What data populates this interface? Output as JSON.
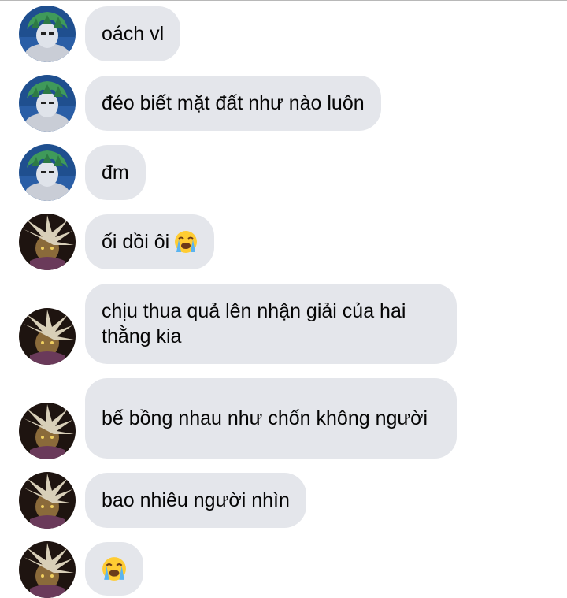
{
  "conversation": {
    "messages": [
      {
        "sender": "user-a",
        "text": "oách vl",
        "emoji": ""
      },
      {
        "sender": "user-a",
        "text": "đéo biết mặt đất như nào luôn",
        "emoji": ""
      },
      {
        "sender": "user-a",
        "text": "đm",
        "emoji": ""
      },
      {
        "sender": "user-b",
        "text": "ối dồi ôi",
        "emoji": "loudly-crying-face-icon"
      },
      {
        "sender": "user-b",
        "text": "chịu thua quả lên nhận giải của hai thằng kia",
        "emoji": ""
      },
      {
        "sender": "user-b",
        "text": "bế bồng nhau như chốn không người",
        "emoji": ""
      },
      {
        "sender": "user-b",
        "text": "bao nhiêu người nhìn",
        "emoji": ""
      },
      {
        "sender": "user-b",
        "text": "",
        "emoji": "loudly-crying-face-icon"
      }
    ]
  },
  "colors": {
    "bubble_bg": "#e4e6eb",
    "text": "#050505",
    "avatar_a_bg": "#1f4f8f",
    "avatar_a_hair": "#3f9a5a",
    "avatar_b_bg": "#1e1410",
    "avatar_b_hair": "#d8cfb8"
  }
}
